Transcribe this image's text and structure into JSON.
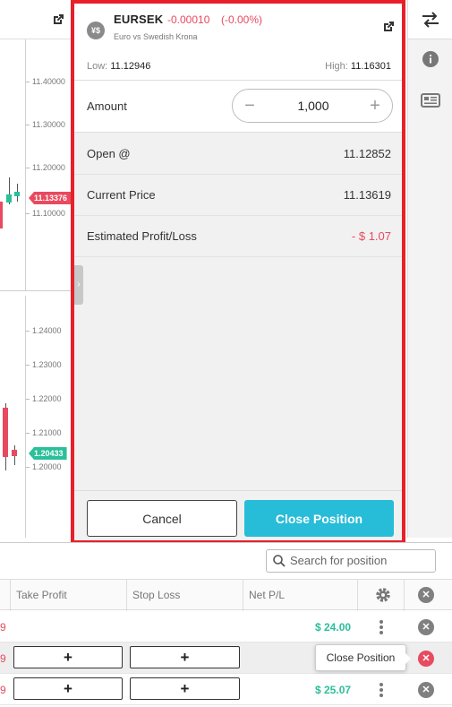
{
  "instrument": {
    "symbol": "EURSEK",
    "change": "-0.00010",
    "change_pct": "(-0.00%)",
    "description": "Euro vs Swedish Krona",
    "icon_text": "¥$",
    "low_label": "Low:",
    "low_value": "11.12946",
    "high_label": "High:",
    "high_value": "11.16301"
  },
  "trade": {
    "amount_label": "Amount",
    "amount_value": "1,000",
    "minus": "−",
    "plus": "+",
    "open_label": "Open @",
    "open_value": "11.12852",
    "current_label": "Current Price",
    "current_value": "11.13619",
    "pl_label": "Estimated Profit/Loss",
    "pl_value": "- $ 1.07",
    "cancel_label": "Cancel",
    "close_label": "Close Position"
  },
  "chart_top": {
    "ticks": [
      "11.40000",
      "11.30000",
      "11.20000",
      "11.10000"
    ],
    "price_tag": "11.13376",
    "tag_color": "#e84a5f"
  },
  "chart_bottom": {
    "ticks": [
      "1.24000",
      "1.23000",
      "1.22000",
      "1.21000",
      "1.20000"
    ],
    "price_tag": "1.20433",
    "tag_color": "#2bbf9a"
  },
  "positions": {
    "search_placeholder": "Search for position",
    "columns": [
      "Take Profit",
      "Stop Loss",
      "Net P/L"
    ],
    "rows": [
      {
        "lead": "9",
        "pnl": "$ 24.00",
        "has_buttons": false
      },
      {
        "lead": "9",
        "pnl": "",
        "has_buttons": true
      },
      {
        "lead": "9",
        "pnl": "$ 25.07",
        "has_buttons": true
      }
    ],
    "plus_label": "+",
    "tooltip": "Close Position"
  },
  "colors": {
    "accent": "#27bcd7",
    "negative": "#e84a5f",
    "positive": "#2bbf9a",
    "highlight_border": "#e8202a"
  }
}
